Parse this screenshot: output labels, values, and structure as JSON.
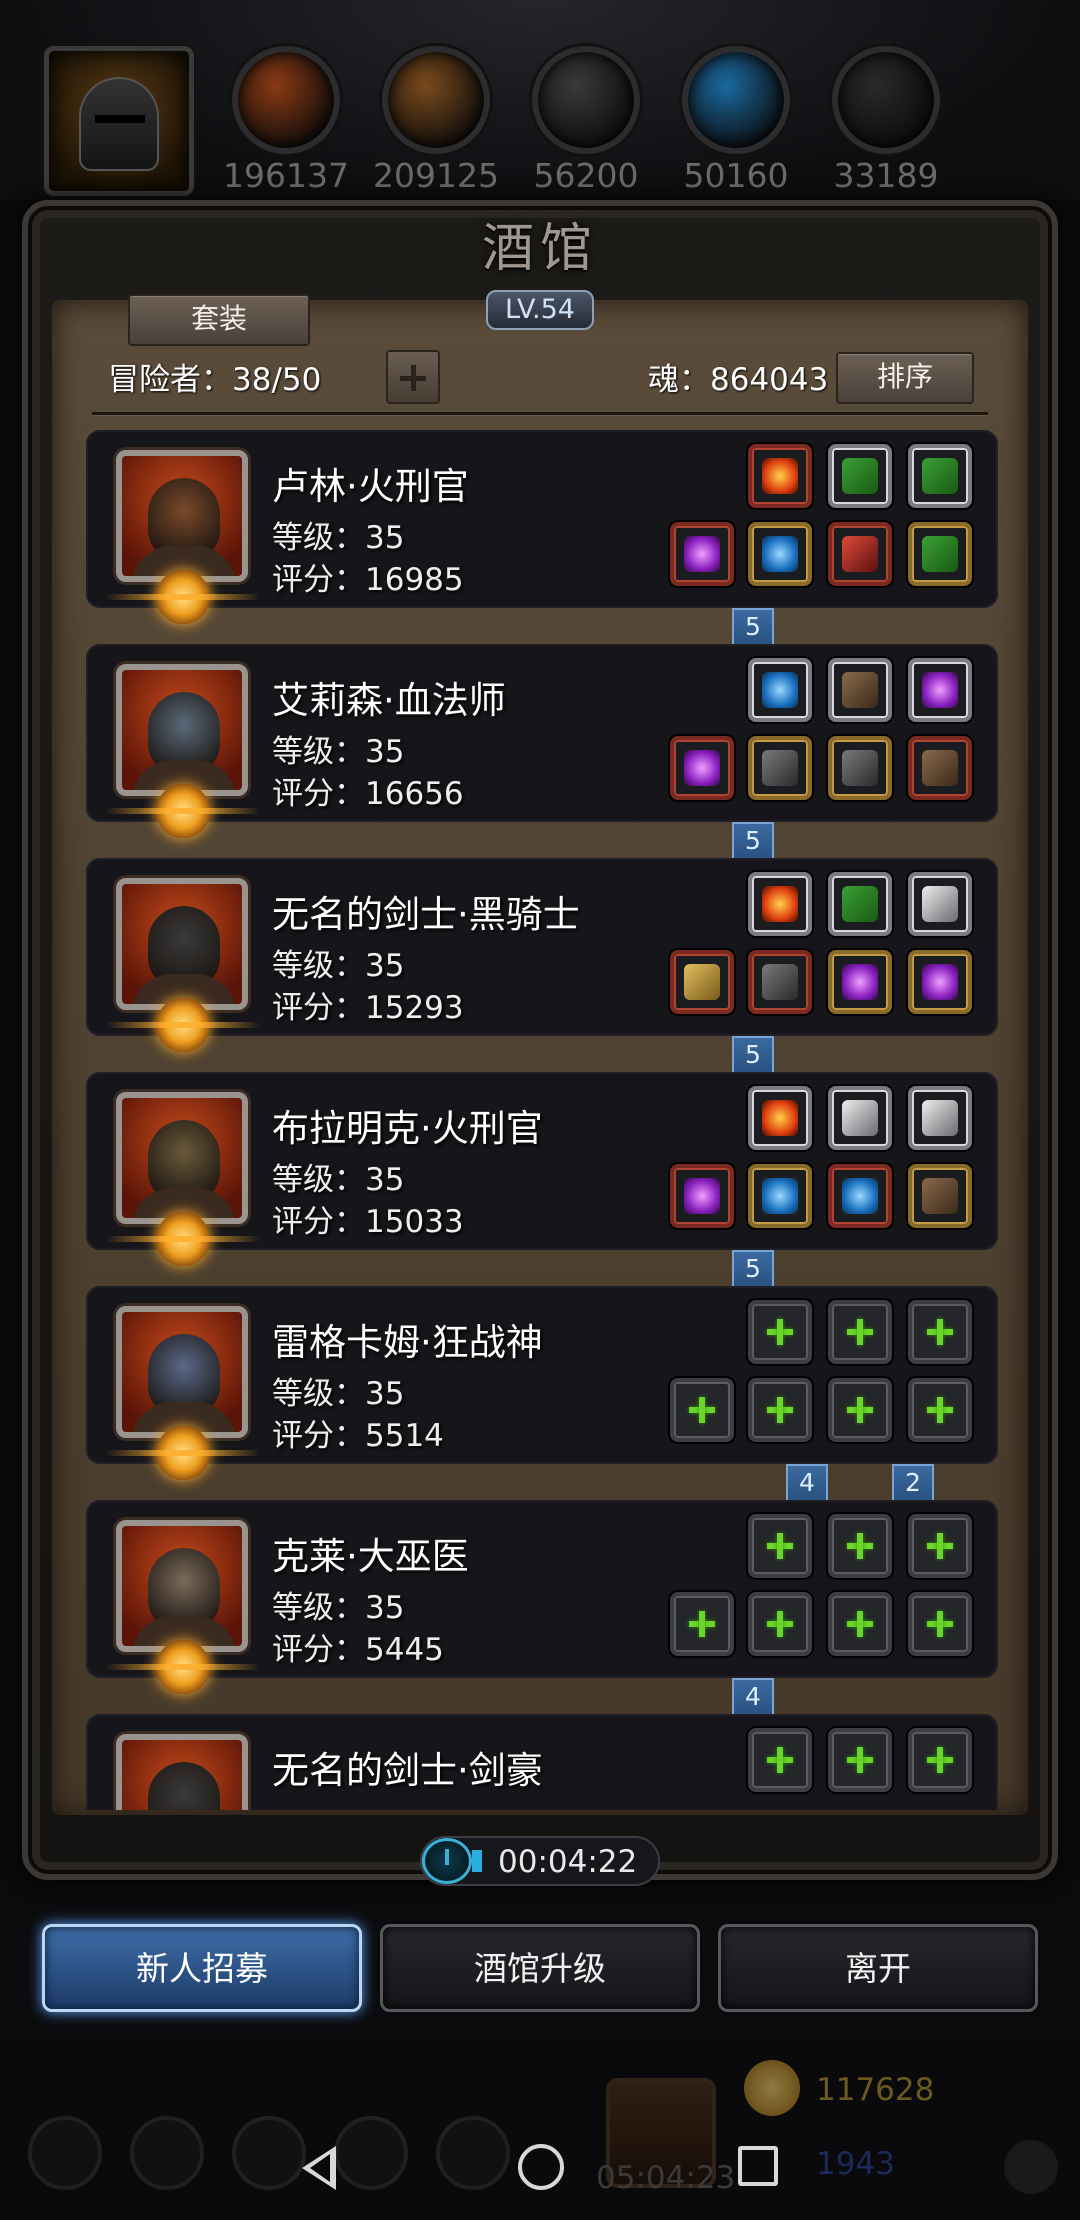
{
  "resources": [
    {
      "name": "meat",
      "value": "196137",
      "color": "#8a3a14"
    },
    {
      "name": "wood",
      "value": "209125",
      "color": "#7a4a1c"
    },
    {
      "name": "iron",
      "value": "56200",
      "color": "#3a3a3a"
    },
    {
      "name": "crystal",
      "value": "50160",
      "color": "#1a6aa0"
    },
    {
      "name": "stone",
      "value": "33189",
      "color": "#2a2a2a"
    }
  ],
  "tavern": {
    "title": "酒馆",
    "level": "LV.54",
    "set_label": "套装",
    "adventurers": "冒险者：38/50",
    "soul": "魂：864043",
    "sort_label": "排序"
  },
  "heroes": [
    {
      "name": "卢林·火刑官",
      "level": "等级：35",
      "score": "评分：16985",
      "face": "#7a4a2a",
      "top": [
        "red",
        "fire",
        "white",
        "green",
        "white",
        "green"
      ],
      "bottom": [
        "red",
        "purple",
        "gold",
        "blue",
        "red",
        "red",
        "gold",
        "green"
      ],
      "ribbons": [
        "5"
      ]
    },
    {
      "name": "艾莉森·血法师",
      "level": "等级：35",
      "score": "评分：16656",
      "face": "#5a6a7a",
      "top": [
        "white",
        "blue",
        "white",
        "brown",
        "white",
        "purple"
      ],
      "bottom": [
        "red",
        "purple",
        "gold",
        "gray",
        "gold",
        "gray",
        "red",
        "brown"
      ],
      "ribbons": [
        "5"
      ]
    },
    {
      "name": "无名的剑士·黑骑士",
      "level": "等级：35",
      "score": "评分：15293",
      "face": "#3a3a3a",
      "top": [
        "white",
        "fire",
        "white",
        "green",
        "white",
        "silver"
      ],
      "bottom": [
        "red",
        "gold",
        "red",
        "gray",
        "gold",
        "purple",
        "gold",
        "purple"
      ],
      "ribbons": [
        "5"
      ]
    },
    {
      "name": "布拉明克·火刑官",
      "level": "等级：35",
      "score": "评分：15033",
      "face": "#6a5a3a",
      "top": [
        "white",
        "fire",
        "white",
        "silver",
        "white",
        "silver"
      ],
      "bottom": [
        "red",
        "purple",
        "gold",
        "blue",
        "red",
        "blue",
        "gold",
        "brown"
      ],
      "ribbons": [
        "5"
      ]
    },
    {
      "name": "雷格卡姆·狂战神",
      "level": "等级：35",
      "score": "评分：5514",
      "face": "#5a6a8a",
      "top": [
        "empty",
        "",
        "empty",
        "",
        "empty",
        ""
      ],
      "bottom": [
        "empty",
        "",
        "empty",
        "",
        "empty",
        "",
        "empty",
        ""
      ],
      "ribbons": [
        "4",
        "2"
      ]
    },
    {
      "name": "克莱·大巫医",
      "level": "等级：35",
      "score": "评分：5445",
      "face": "#7a6a5a",
      "top": [
        "empty",
        "",
        "empty",
        "",
        "empty",
        ""
      ],
      "bottom": [
        "empty",
        "",
        "empty",
        "",
        "empty",
        "",
        "empty",
        ""
      ],
      "ribbons": [
        "4"
      ]
    },
    {
      "name": "无名的剑士·剑豪",
      "level": "",
      "score": "",
      "face": "#3a3a3a",
      "top": [
        "empty",
        "",
        "empty",
        "",
        "empty",
        ""
      ],
      "bottom": [],
      "ribbons": []
    }
  ],
  "timer": "00:04:22",
  "buttons": {
    "recruit": "新人招募",
    "upgrade": "酒馆升级",
    "leave": "离开"
  },
  "hud": {
    "gift_time": "05:04:23",
    "gold": "117628",
    "gems": "1943"
  }
}
